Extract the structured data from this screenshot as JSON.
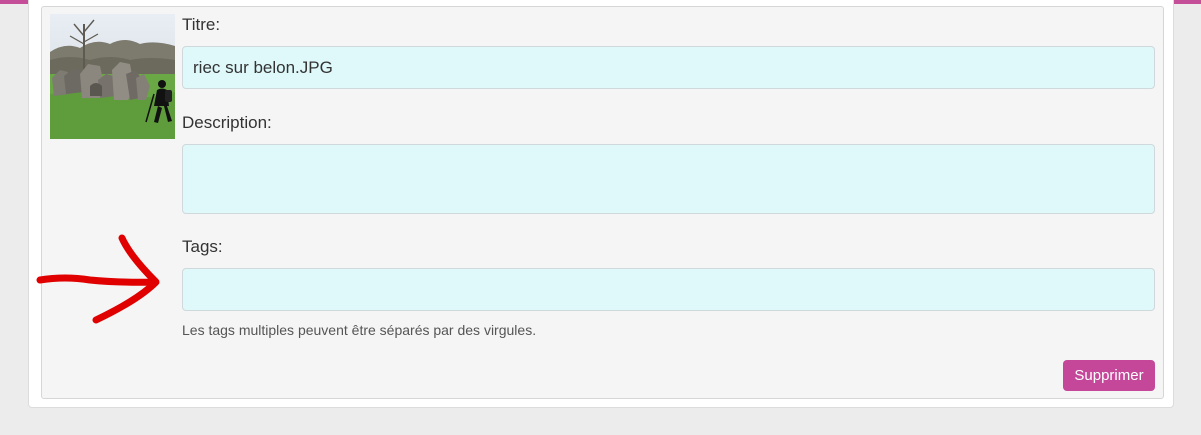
{
  "form": {
    "title_label": "Titre:",
    "title_value": "riec sur belon.JPG",
    "description_label": "Description:",
    "description_value": "",
    "tags_label": "Tags:",
    "tags_value": "",
    "tags_help": "Les tags multiples peuvent être séparés par des virgules.",
    "delete_label": "Supprimer"
  },
  "colors": {
    "accent": "#c4479a",
    "input_background": "#dff9fb",
    "annotation": "#e00000"
  },
  "icons": {
    "annotation": "red-arrow-icon"
  }
}
